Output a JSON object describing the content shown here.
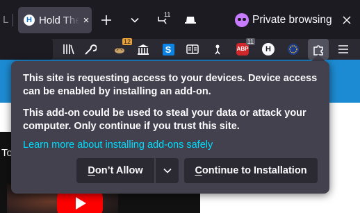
{
  "tabs": {
    "previous_tab_label": "L",
    "active": {
      "favicon_letter": "H",
      "title": "Hold The Front Page",
      "close": "×"
    },
    "new_tab": "+",
    "list_all_tabs": "⌄",
    "firefox_view_badge": "11",
    "private_browsing_label": "Private browsing",
    "window_close": "×"
  },
  "toolbar": {
    "badges": {
      "extension_a": "12",
      "adblock": "11"
    },
    "h_letter": "H",
    "s_letter": "S",
    "abp_text": "ABP"
  },
  "page": {
    "video_text": "To"
  },
  "prompt": {
    "message": "This site is requesting access to your devices. Device access can be enabled by installing an add-on.",
    "warning": "This add-on could be used to steal your data or attack your computer. Only continue if you trust this site.",
    "learn_more": "Learn more about installing add-ons safely",
    "deny_accesskey": "D",
    "deny_rest": "on’t Allow",
    "continue_accesskey": "C",
    "continue_rest": "ontinue to Installation"
  },
  "colors": {
    "panel_bg": "#42414d",
    "button_bg": "#2b2a33",
    "link": "#00ddff",
    "private_accent": "#c77bff",
    "page_band": "#1d8bd3"
  },
  "icons": [
    "library-icon",
    "wrench-icon",
    "extension-badge-icon",
    "museum-icon",
    "s-extension-icon",
    "reader-icon",
    "pin-icon",
    "adblock-icon",
    "h-extension-icon",
    "eu-flag-icon",
    "extensions-puzzle-icon",
    "menu-icon"
  ]
}
